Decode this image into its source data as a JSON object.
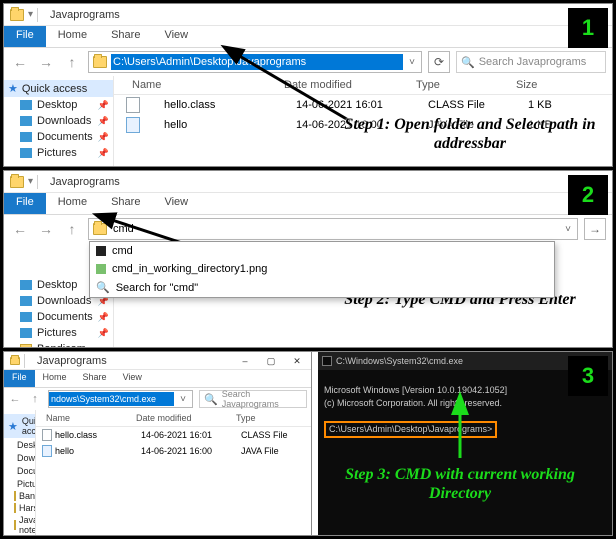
{
  "window_title": "Javaprograms",
  "ribbon": {
    "file": "File",
    "home": "Home",
    "share": "Share",
    "view": "View"
  },
  "nav": {
    "back": "←",
    "fwd": "→",
    "up": "↑",
    "refresh": "⟳",
    "dropdown": "˅"
  },
  "addr_path_full": "C:\\Users\\Admin\\Desktop\\Javaprograms",
  "addr_cmd": "cmd",
  "addr_p3": "ndows\\System32\\cmd.exe",
  "search_placeholder": "Search Javaprograms",
  "sidebar": {
    "quick_access": "Quick access",
    "items": [
      "Desktop",
      "Downloads",
      "Documents",
      "Pictures",
      "Bandicam",
      "Harshu",
      "Java notepad+..."
    ]
  },
  "columns": {
    "name": "Name",
    "date": "Date modified",
    "type": "Type",
    "size": "Size"
  },
  "files": [
    {
      "name": "hello.class",
      "date": "14-06-2021 16:01",
      "type": "CLASS File",
      "size": "1 KB",
      "kind": "class"
    },
    {
      "name": "hello",
      "date": "14-06-2021 16:00",
      "type": "JAVA File",
      "size": "1 KB",
      "kind": "java"
    }
  ],
  "suggestions": {
    "row1": "cmd",
    "row2": "cmd_in_working_directory1.png",
    "row3": "Search for \"cmd\""
  },
  "cmd": {
    "title": "C:\\Windows\\System32\\cmd.exe",
    "line1": "Microsoft Windows [Version 10.0.19042.1052]",
    "line2": "(c) Microsoft Corporation. All rights reserved.",
    "prompt": "C:\\Users\\Admin\\Desktop\\Javaprograms>"
  },
  "steps": {
    "n1": "1",
    "n2": "2",
    "n3": "3",
    "c1": "Step 1: Open folder and Select path in addressbar",
    "c2": "Step 2: Type CMD and Press Enter",
    "c3": "Step 3: CMD with current working Directory"
  }
}
